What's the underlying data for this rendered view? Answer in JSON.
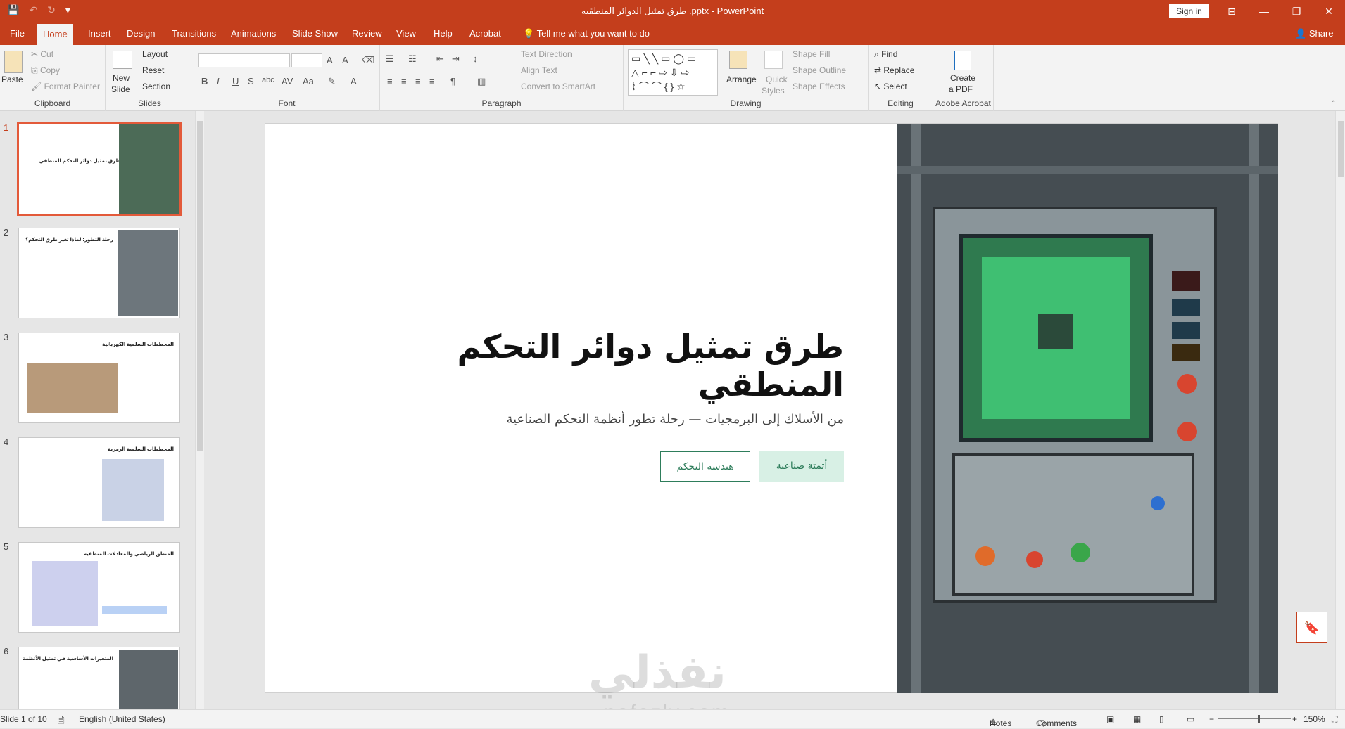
{
  "window": {
    "title": "طرق تمثيل الدوائر المنطقيه .pptx - PowerPoint",
    "signin": "Sign in",
    "minimize": "—",
    "restore": "❐",
    "close": "✕",
    "ribbon_display": "⊟"
  },
  "qat": {
    "save": "💾",
    "undo": "↶",
    "redo": "↻",
    "customize": "▾"
  },
  "tabs": [
    {
      "label": "File"
    },
    {
      "label": "Home"
    },
    {
      "label": "Insert"
    },
    {
      "label": "Design"
    },
    {
      "label": "Transitions"
    },
    {
      "label": "Animations"
    },
    {
      "label": "Slide Show"
    },
    {
      "label": "Review"
    },
    {
      "label": "View"
    },
    {
      "label": "Help"
    },
    {
      "label": "Acrobat"
    }
  ],
  "tell_me": "Tell me what you want to do",
  "share": "Share",
  "ribbon": {
    "clipboard": {
      "label": "Clipboard",
      "paste": "Paste",
      "cut": "Cut",
      "copy": "Copy",
      "format_painter": "Format Painter"
    },
    "slides": {
      "label": "Slides",
      "new_slide_1": "New",
      "new_slide_2": "Slide",
      "layout": "Layout",
      "reset": "Reset",
      "section": "Section"
    },
    "font": {
      "label": "Font",
      "font_name": "",
      "font_size": ""
    },
    "paragraph": {
      "label": "Paragraph",
      "text_direction": "Text Direction",
      "align_text": "Align Text",
      "convert_smartart": "Convert to SmartArt"
    },
    "drawing": {
      "label": "Drawing",
      "arrange": "Arrange",
      "quick_styles_1": "Quick",
      "quick_styles_2": "Styles",
      "shape_fill": "Shape Fill",
      "shape_outline": "Shape Outline",
      "shape_effects": "Shape Effects"
    },
    "editing": {
      "label": "Editing",
      "find": "Find",
      "replace": "Replace",
      "select": "Select"
    },
    "acrobat": {
      "label": "Adobe Acrobat",
      "create_pdf_1": "Create",
      "create_pdf_2": "a PDF"
    }
  },
  "thumbnails": [
    {
      "num": "1",
      "title": "طرق تمثيل دوائر التحكم المنطقي"
    },
    {
      "num": "2",
      "title": "رحلة التطور: لماذا تغير طرق التحكم؟"
    },
    {
      "num": "3",
      "title": "المخططات السلمية الكهربائية"
    },
    {
      "num": "4",
      "title": "المخططات السلمية الرمزية"
    },
    {
      "num": "5",
      "title": "المنطق الرياضي والمعادلات المنطقية"
    },
    {
      "num": "6",
      "title": "المتغيرات الأساسية في تمثيل الأنظمة"
    }
  ],
  "slide": {
    "title": "طرق تمثيل دوائر التحكم المنطقي",
    "subtitle": "من الأسلاك إلى البرمجيات — رحلة تطور أنظمة التحكم الصناعية",
    "badge_filled": "أتمتة صناعية",
    "badge_outline": "هندسة التحكم"
  },
  "watermark": {
    "arabic": "نفذلي",
    "latin": "nafezly.com"
  },
  "status": {
    "slide_of": "Slide 1 of 10",
    "language": "English (United States)",
    "notes": "Notes",
    "comments": "Comments",
    "zoom": "150%"
  },
  "colors": {
    "accent": "#c43e1c",
    "badge_green": "#2e7d5b",
    "badge_fill": "#d8f0e5"
  }
}
